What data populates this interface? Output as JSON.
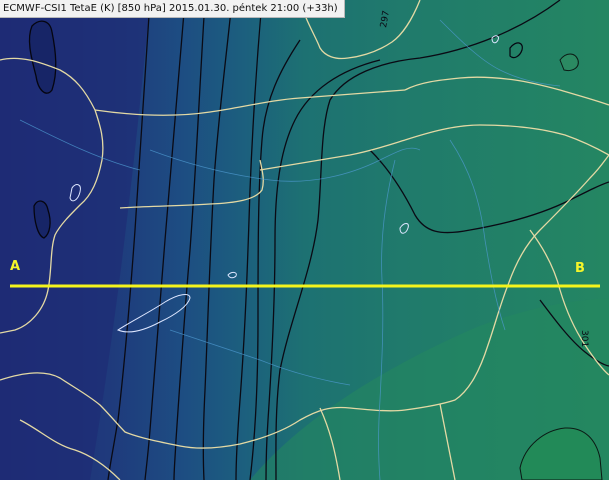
{
  "map": {
    "title": "ECMWF-CSI1 TetaE (K) [850 hPa] 2015.01.30. péntek 21:00 (+33h)",
    "cross_section": {
      "start_label": "A",
      "end_label": "B",
      "color": "#f4f41c"
    },
    "contour_labels": [
      "297",
      "301"
    ],
    "colors": {
      "cold": "#1e2e78",
      "mid": "#1d4d82",
      "warm": "#1e7270",
      "hot": "#238862",
      "borders": "#e3d9a4",
      "contours": "#0a0a14",
      "water": "#dde6ff"
    }
  }
}
